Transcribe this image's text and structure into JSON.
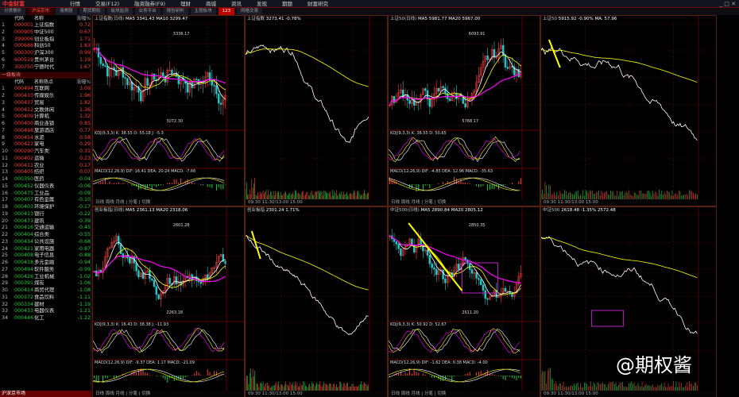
{
  "app": {
    "logo": "中金财富"
  },
  "menu": [
    "行情",
    "交易(F12)",
    "融资融券(F9)",
    "理财",
    "商城",
    "资讯",
    "发现",
    "期题",
    "财富研究"
  ],
  "tabs": [
    {
      "label": "分类报价",
      "active": false
    },
    {
      "label": "沪深京市",
      "active": true
    },
    {
      "label": "港美股",
      "active": false
    },
    {
      "label": "期货期权",
      "active": false
    },
    {
      "label": "板块监测",
      "active": false
    },
    {
      "label": "业务平台",
      "active": false
    },
    {
      "label": "报告研判",
      "active": false
    },
    {
      "label": "主题板块",
      "active": false
    },
    {
      "label": "123",
      "red": true
    },
    {
      "label": "网格交易",
      "active": false
    }
  ],
  "sidebar": {
    "top_header": [
      "代码",
      "名称",
      "涨幅%"
    ],
    "top_rows": [
      {
        "n": "1",
        "code": "000001",
        "name": "上证指数",
        "chg": "0.72",
        "dir": "up"
      },
      {
        "n": "2",
        "code": "000905",
        "name": "中证500",
        "chg": "0.67",
        "dir": "up"
      },
      {
        "n": "3",
        "code": "399006",
        "name": "创业板指",
        "chg": "1.71",
        "dir": "up"
      },
      {
        "n": "4",
        "code": "000688",
        "name": "科创50",
        "chg": "1.83",
        "dir": "up"
      },
      {
        "n": "5",
        "code": "000300",
        "name": "沪深300",
        "chg": "0.99",
        "dir": "up"
      },
      {
        "n": "6",
        "code": "600519",
        "name": "贵州茅台",
        "chg": "1.19",
        "dir": "up"
      },
      {
        "n": "7",
        "code": "300750",
        "name": "宁德时代",
        "chg": "1.67",
        "dir": "up"
      }
    ],
    "section_label": "一级板块",
    "list_header": [
      "代码",
      "名称热点",
      "涨幅%"
    ],
    "list_rows": [
      {
        "n": "1",
        "code": "000494",
        "name": "互联网",
        "chg": "3.09",
        "dir": "up"
      },
      {
        "n": "2",
        "code": "000410",
        "name": "传媒娱乐",
        "chg": "1.96",
        "dir": "up"
      },
      {
        "n": "3",
        "code": "000437",
        "name": "贸易",
        "chg": "1.82",
        "dir": "up"
      },
      {
        "n": "4",
        "code": "000412",
        "name": "文教休闲",
        "chg": "1.36",
        "dir": "up"
      },
      {
        "n": "5",
        "code": "000409",
        "name": "计算机",
        "chg": "1.32",
        "dir": "up"
      },
      {
        "n": "6",
        "code": "000400",
        "name": "商业连锁",
        "chg": "0.85",
        "dir": "up"
      },
      {
        "n": "7",
        "code": "000498",
        "name": "旅游酒店",
        "chg": "0.77",
        "dir": "up"
      },
      {
        "n": "8",
        "code": "000454",
        "name": "水泥",
        "chg": "0.58",
        "dir": "up"
      },
      {
        "n": "9",
        "code": "000423",
        "name": "家电",
        "chg": "0.29",
        "dir": "up"
      },
      {
        "n": "10",
        "code": "000290",
        "name": "汽车类",
        "chg": "0.31",
        "dir": "up"
      },
      {
        "n": "11",
        "code": "000402",
        "name": "运输",
        "chg": "0.23",
        "dir": "up"
      },
      {
        "n": "12",
        "code": "000411",
        "name": "农业",
        "chg": "0.17",
        "dir": "up"
      },
      {
        "n": "13",
        "code": "000405",
        "name": "纺织",
        "chg": "0.07",
        "dir": "up"
      },
      {
        "n": "14",
        "code": "000350",
        "name": "医药",
        "chg": "-0.04",
        "dir": "dn"
      },
      {
        "n": "15",
        "code": "000452",
        "name": "仪器仪表",
        "chg": "-0.06",
        "dir": "dn"
      },
      {
        "n": "16",
        "code": "000475",
        "name": "工业品",
        "chg": "-0.09",
        "dir": "dn"
      },
      {
        "n": "17",
        "code": "000407",
        "name": "有色金属",
        "chg": "-0.10",
        "dir": "dn"
      },
      {
        "n": "18",
        "code": "000403",
        "name": "环境保护",
        "chg": "-0.17",
        "dir": "dn"
      },
      {
        "n": "19",
        "code": "000413",
        "name": "银行",
        "chg": "-0.22",
        "dir": "dn"
      },
      {
        "n": "20",
        "code": "000473",
        "name": "建筑",
        "chg": "-0.39",
        "dir": "dn"
      },
      {
        "n": "21",
        "code": "000416",
        "name": "交通运输",
        "chg": "-0.45",
        "dir": "dn"
      },
      {
        "n": "22",
        "code": "000404",
        "name": "综合类",
        "chg": "-0.55",
        "dir": "dn"
      },
      {
        "n": "23",
        "code": "000434",
        "name": "公共设施",
        "chg": "-0.68",
        "dir": "dn"
      },
      {
        "n": "24",
        "code": "000421",
        "name": "家用电器",
        "chg": "-0.87",
        "dir": "dn"
      },
      {
        "n": "25",
        "code": "000408",
        "name": "电子信息",
        "chg": "-0.88",
        "dir": "dn"
      },
      {
        "n": "26",
        "code": "000418",
        "name": "多元金融",
        "chg": "-0.94",
        "dir": "dn"
      },
      {
        "n": "27",
        "code": "000494",
        "name": "软件服务",
        "chg": "-0.99",
        "dir": "dn"
      },
      {
        "n": "28",
        "code": "000426",
        "name": "工业机械",
        "chg": "-1.02",
        "dir": "dn"
      },
      {
        "n": "29",
        "code": "000391",
        "name": "煤炭",
        "chg": "-1.06",
        "dir": "dn"
      },
      {
        "n": "30",
        "code": "000414",
        "name": "商贸代理",
        "chg": "-1.08",
        "dir": "dn"
      },
      {
        "n": "31",
        "code": "000372",
        "name": "食品饮料",
        "chg": "-1.11",
        "dir": "dn"
      },
      {
        "n": "32",
        "code": "000334",
        "name": "建材",
        "chg": "-1.19",
        "dir": "dn"
      },
      {
        "n": "33",
        "code": "000433",
        "name": "电器仪表",
        "chg": "-1.21",
        "dir": "dn"
      },
      {
        "n": "34",
        "code": "000446",
        "name": "化工",
        "chg": "-1.22",
        "dir": "dn"
      }
    ],
    "footer": "沪深京市场"
  },
  "panels": [
    {
      "title": "上证指数(日线)",
      "ma": "MA5 3341.43 MA10 3299.47",
      "high": "3336.17",
      "low": "3072.30",
      "ind1": "KDJ(9,3,3) K: 38.55 D: 55.18 J: -5.3",
      "ind2": "MACD(12,26,9) DIF: 16.41 DEA: 20.24 MACD: -7.66",
      "foot": "日线 周线 月线 | 分笔 | 切换"
    },
    {
      "title": "上证指数",
      "ma": "3273.41 -0.78%",
      "foot": "09:30 11:30/13:00 15:00"
    },
    {
      "title": "上证50(日线)",
      "ma": "MA5 5981.77 MA20 5967.00",
      "high": "6093.91",
      "low": "5768.17",
      "ind1": "KDJ(9,3,3) K: 38.55 D: 50.65",
      "ind2": "MACD(12,26,9) DIF: -4.85 DEA: 12.96 MACD: -35.63",
      "foot": "日线 周线 月线 | 分笔 | 切换"
    },
    {
      "title": "上证50",
      "ma": "5915.92 -0.90% MA: 57.96",
      "foot": "09:30 11:30/13:00 15:00"
    },
    {
      "title": "创业板指(日线)",
      "ma": "MA5 2361.13 MA20 2318.06",
      "high": "2601.28",
      "low": "2263.18",
      "ind1": "KDJ(9,3,3) K: 16.43 D: 38.38 J: -11.93",
      "ind2": "MACD(12,26,9) DIF: -9.37 DEA: 1.17 MACD: -21.09",
      "foot": "日线 周线 月线 | 分笔 | 切换"
    },
    {
      "title": "创业板指",
      "ma": "2301.24 1.71%",
      "foot": "09:30 11:30/13:00 15:00"
    },
    {
      "title": "中证500(日线)",
      "ma": "MA5 2890.84 MA20 2805.12",
      "high": "2850.35",
      "low": "2611.20",
      "ind1": "KDJ(9,3,3) K: 50.92 D: 52.67",
      "ind2": "MACD(12,26,9) DIF: -1.62 DEA: 0.38 MACD: -4.00",
      "foot": "日线 周线 月线 | 分笔 | 切换"
    },
    {
      "title": "中证500",
      "ma": "2618.48 -1.35% 2572.48",
      "foot": "09:30 11:30/13:00 15:00"
    }
  ],
  "watermark": "@期权酱",
  "colors": {
    "up": "#ff4040",
    "down": "#20d040",
    "grid": "#5a1010",
    "ma5": "#ffffff",
    "ma10": "#ffff00",
    "ma20": "#ff00ff",
    "arrow": "#ffff00",
    "highlight": "#c020c0"
  }
}
